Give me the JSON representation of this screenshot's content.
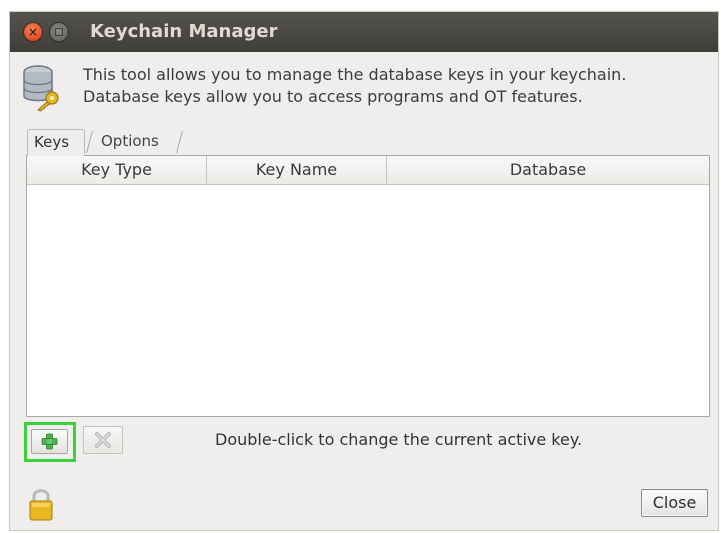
{
  "window": {
    "title": "Keychain Manager"
  },
  "intro": {
    "line1": "This tool allows you to manage the database keys in your keychain.",
    "line2": "Database keys allow you to access programs and OT features."
  },
  "tabs": [
    {
      "label": "Keys",
      "selected": true
    },
    {
      "label": "Options",
      "selected": false
    }
  ],
  "table": {
    "columns": [
      "Key Type",
      "Key Name",
      "Database"
    ],
    "rows": []
  },
  "footer": {
    "hint": "Double-click to change the current active key.",
    "close_label": "Close"
  },
  "icons": {
    "add": "plus-icon",
    "remove": "x-icon",
    "database": "database-key-icon",
    "lock": "lock-icon"
  },
  "colors": {
    "titlebar": "#4a4945",
    "highlight": "#3cd03c",
    "add_plus": "#3aa23a"
  }
}
